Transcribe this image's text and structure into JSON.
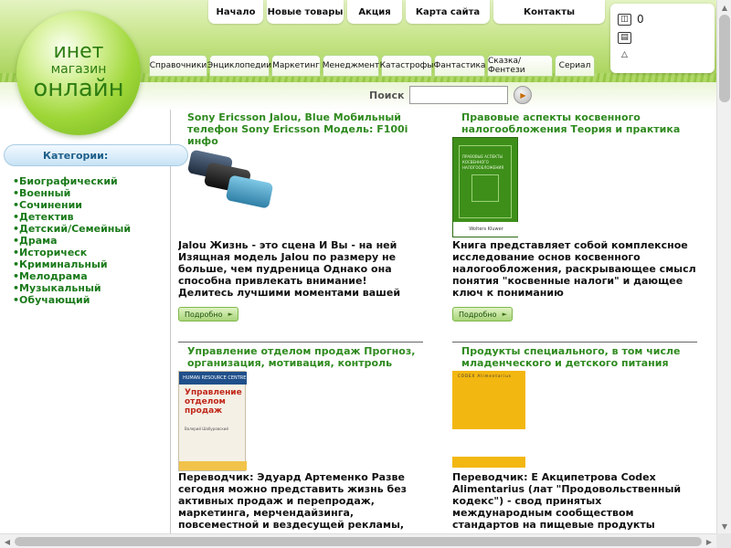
{
  "logo": {
    "line1": "инет",
    "line2": "магазин",
    "line3": "онлайн"
  },
  "top_nav": [
    "Начало",
    "Новые товары",
    "Акция",
    "Карта сайта",
    "Контакты"
  ],
  "category_nav": [
    "Справочники",
    "Энциклопедии",
    "Маркетинг",
    "Менеджмент",
    "Катастрофы",
    "Фантастика",
    "Сказка/Фентези",
    "Сериал"
  ],
  "cart": {
    "count": "0"
  },
  "search": {
    "label": "Поиск",
    "value": "",
    "placeholder": ""
  },
  "sidebar": {
    "header": "Категории:",
    "items": [
      "•Биографический",
      "•Военный",
      "•Сочинении",
      "•Детектив",
      "•Детский/Семейный",
      "•Драма",
      "•Историческ",
      "•Криминальный",
      "•Мелодрама",
      "•Музыкальный",
      "•Обучающий"
    ]
  },
  "products": [
    {
      "title": "Sony Ericsson Jalou, Blue Мобильный телефон Sony Ericsson Модель: F100i инфо",
      "description": "Jalou Жизнь - это сцена И Вы - на ней Изящная модель Jalou по размеру не больше, чем пудреница Однако она способна привлекать внимание! Делитесь лучшими моментами вашей жизни в объективе с камерой",
      "more": "Подробно"
    },
    {
      "title": "Правовые аспекты косвенного налогообложения Теория и практика",
      "description": "Книга представляет собой комплексное исследование основ косвенного налогообложения, раскрывающее смысл понятия \"косвенные налоги\" и дающее ключ к пониманию",
      "more": "Подробно",
      "cover": {
        "title": "ПРАВОВЫЕ АСПЕКТЫ КОСВЕННОГО НАЛОГООБЛОЖЕНИЯ",
        "publisher": "Wolters Kluwer"
      }
    },
    {
      "title": "Управление отделом продаж Прогноз, организация, мотивация, контроль",
      "description": "Переводчик: Эдуард Артеменко Разве сегодня можно представить жизнь без активных продаж и перепродаж, маркетинга, мерчендайзинга, повсеместной и вездесущей рекламы,",
      "cover": {
        "band": "HUMAN RESOURCE CENTRE",
        "title": "Управление отделом продаж",
        "author": "Валерий Шабуровский"
      }
    },
    {
      "title": "Продукты специального, в том числе младенческого и детского питания Серия:",
      "description": "Переводчик: Е Акципетрова Codex Alimentarius (лат \"Продовольственный кодекс\") - свод принятых международным сообществом стандартов на пищевые продукты",
      "cover": {
        "header": "CODEX Alimentarius"
      }
    }
  ],
  "colors": {
    "accent_green": "#2f8a1f",
    "category_blue": "#1d5f8a",
    "book_green": "#3e8f1a",
    "book_yellow": "#f3b711"
  }
}
